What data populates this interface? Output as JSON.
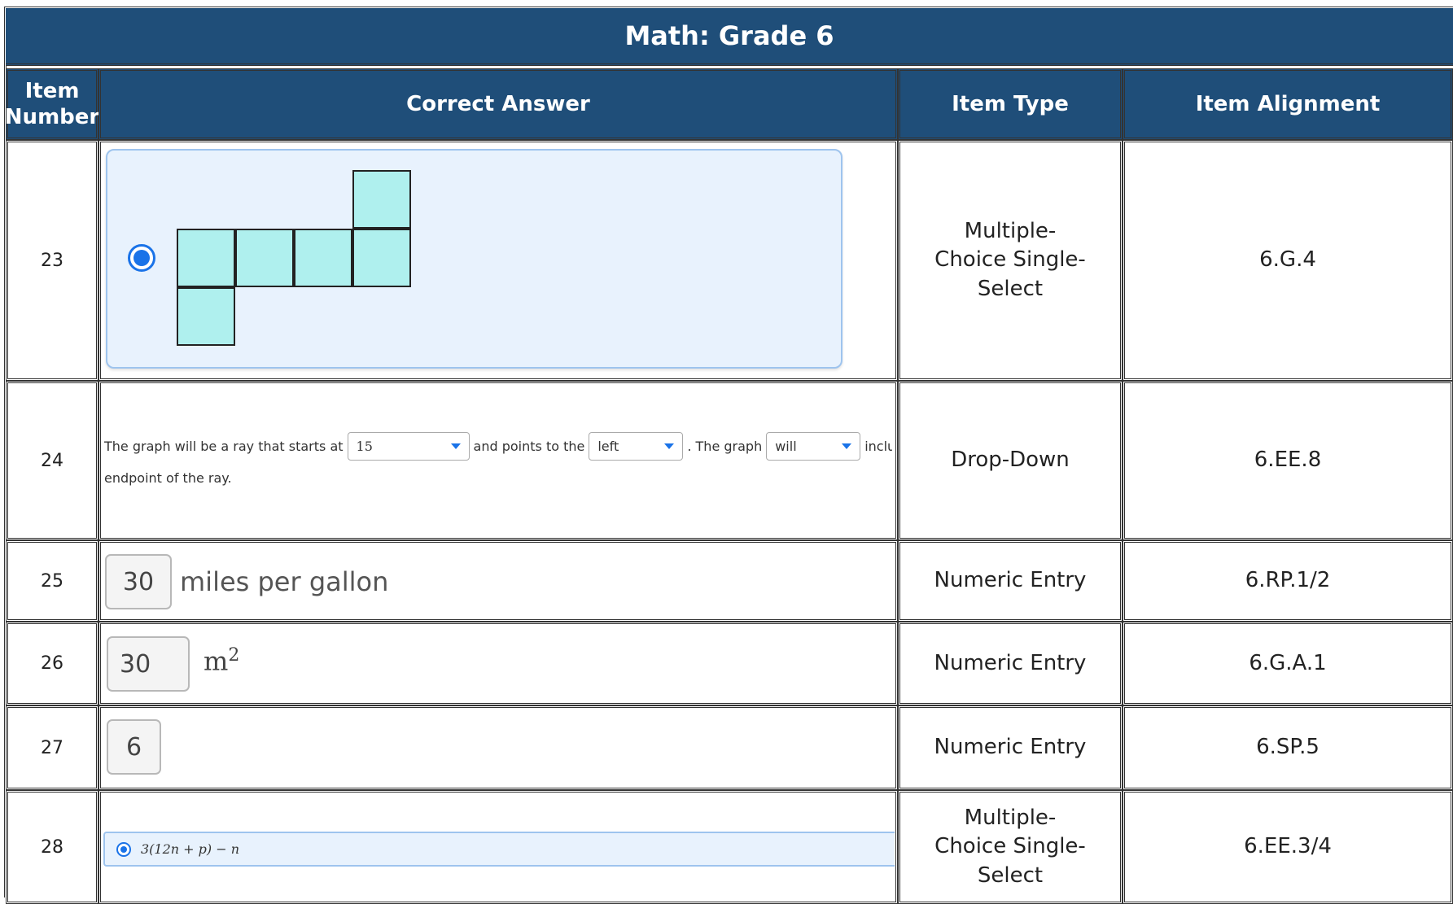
{
  "title": "Math: Grade 6",
  "headers": {
    "item_number": "Item Number",
    "correct_answer": "Correct Answer",
    "item_type": "Item Type",
    "item_alignment": "Item Alignment"
  },
  "rows": [
    {
      "number": "23",
      "type": "Multiple-Choice Single-Select",
      "alignment": "6.G.4",
      "answer": {
        "kind": "multiple-choice",
        "selected": true,
        "figure": "cube-net"
      }
    },
    {
      "number": "24",
      "type": "Drop-Down",
      "alignment": "6.EE.8",
      "answer": {
        "kind": "drop-down",
        "text1": "The graph will be a ray that starts at",
        "sel1": "15",
        "text2": "and points to the",
        "sel2": "left",
        "text3": ". The graph",
        "sel3": "will",
        "text4": "include th",
        "line2": "endpoint of the ray."
      }
    },
    {
      "number": "25",
      "type": "Numeric Entry",
      "alignment": "6.RP.1/2",
      "answer": {
        "kind": "numeric",
        "value": "30",
        "label": "miles per gallon"
      }
    },
    {
      "number": "26",
      "type": "Numeric Entry",
      "alignment": "6.G.A.1",
      "answer": {
        "kind": "numeric",
        "value": "30",
        "unit": "m",
        "unit_exp": "2"
      }
    },
    {
      "number": "27",
      "type": "Numeric Entry",
      "alignment": "6.SP.5",
      "answer": {
        "kind": "numeric",
        "value": "6"
      }
    },
    {
      "number": "28",
      "type": "Multiple-Choice Single-Select",
      "alignment": "6.EE.3/4",
      "answer": {
        "kind": "multiple-choice",
        "selected": true,
        "expression": "3(12n + p) − n"
      }
    }
  ],
  "colors": {
    "header_bg": "#1f4e79",
    "header_text": "#ffffff",
    "selection": "#1a73e8",
    "card_bg": "#e8f2fd",
    "net_fill": "#aff0ee"
  }
}
